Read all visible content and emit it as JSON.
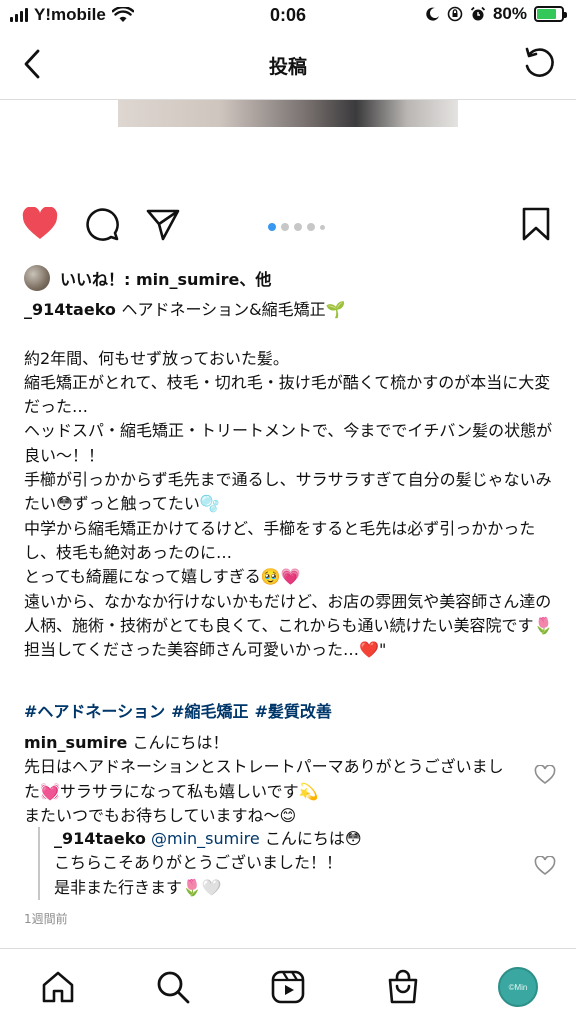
{
  "status_bar": {
    "carrier": "Y!mobile",
    "time": "0:06",
    "battery": "80%",
    "battery_level": 0.8
  },
  "nav": {
    "title": "投稿"
  },
  "carousel": {
    "count": 5,
    "active_index": 0
  },
  "likes": {
    "text": "いいね！: min_sumire、他"
  },
  "caption": {
    "username": "_914taeko",
    "lines": [
      "ヘアドネーション&縮毛矯正🌱",
      "",
      "約2年間、何もせず放っておいた髪。",
      "縮毛矯正がとれて、枝毛・切れ毛・抜け毛が酷くて梳かすのが本当に大変だった…",
      "ヘッドスパ・縮毛矯正・トリートメントで、今まででイチバン髪の状態が良い〜！！",
      "手櫛が引っかからず毛先まで通るし、サラサラすぎて自分の髪じゃないみたい😳ずっと触ってたい🫧",
      "中学から縮毛矯正かけてるけど、手櫛をすると毛先は必ず引っかかったし、枝毛も絶対あったのに…",
      "とっても綺麗になって嬉しすぎる🥹💗",
      "遠いから、なかなか行けないかもだけど、お店の雰囲気や美容師さん達の人柄、施術・技術がとても良くて、これからも通い続けたい美容院です🌷",
      "担当してくださった美容師さん可愛いかった…❤️\""
    ]
  },
  "hashtags": [
    "#ヘアドネーション",
    "#縮毛矯正",
    "#髪質改善"
  ],
  "comments": [
    {
      "username": "min_sumire",
      "text": "こんにちは！\n先日はヘアドネーションとストレートパーマありがとうございました💓サラサラになって私も嬉しいです💫\nまたいつでもお待ちしていますね〜😊"
    }
  ],
  "reply": {
    "username": "_914taeko",
    "mention": "@min_sumire",
    "text": "こんにちは😳\nこちらこそありがとうございました！！\n是非また行きます🌷🤍"
  },
  "timestamp": "1週間前",
  "profile": {
    "avatar_text": "©Min"
  },
  "colors": {
    "heart": "#ed4956",
    "hashtag": "#00376b",
    "carousel_active": "#3897f0",
    "profile_avatar": "#3aa8a0"
  }
}
